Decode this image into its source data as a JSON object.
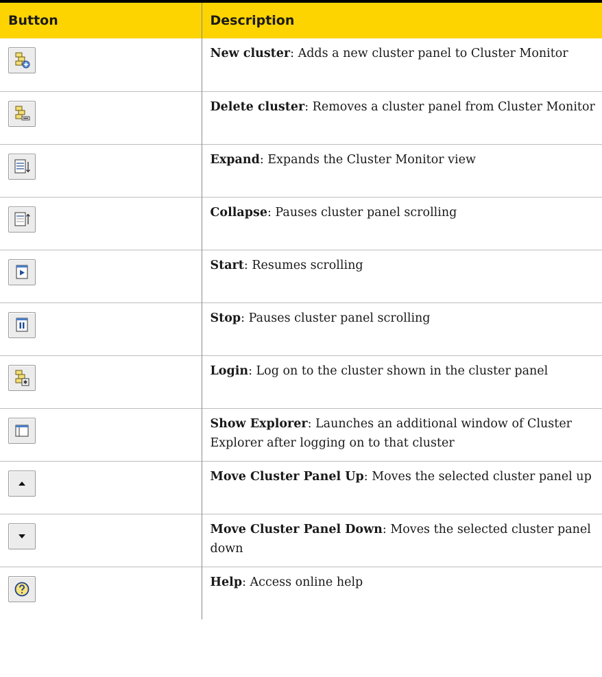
{
  "table": {
    "headers": {
      "button": "Button",
      "description": "Description"
    },
    "rows": [
      {
        "icon": "new-cluster-icon",
        "term": "New cluster",
        "text": ": Adds a new cluster panel to Cluster Monitor"
      },
      {
        "icon": "delete-cluster-icon",
        "term": "Delete cluster",
        "text": ": Removes a cluster panel from Cluster Monitor"
      },
      {
        "icon": "expand-icon",
        "term": "Expand",
        "text": ": Expands the Cluster Monitor view"
      },
      {
        "icon": "collapse-icon",
        "term": "Collapse",
        "text": ": Pauses cluster panel scrolling"
      },
      {
        "icon": "start-icon",
        "term": "Start",
        "text": ": Resumes scrolling"
      },
      {
        "icon": "stop-icon",
        "term": "Stop",
        "text": ": Pauses cluster panel scrolling"
      },
      {
        "icon": "login-icon",
        "term": "Login",
        "text": ": Log on to the cluster shown in the cluster panel"
      },
      {
        "icon": "show-explorer-icon",
        "term": "Show Explorer",
        "text": ": Launches an additional window of Cluster Explorer after logging on to that cluster"
      },
      {
        "icon": "move-up-icon",
        "term": "Move Cluster Panel Up",
        "text": ": Moves the selected cluster panel up"
      },
      {
        "icon": "move-down-icon",
        "term": "Move Cluster Panel Down",
        "text": ": Moves the selected cluster panel down"
      },
      {
        "icon": "help-icon",
        "term": "Help",
        "text": ": Access online help"
      }
    ]
  },
  "colors": {
    "header_background": "#fdd400",
    "header_rule": "#000000"
  }
}
